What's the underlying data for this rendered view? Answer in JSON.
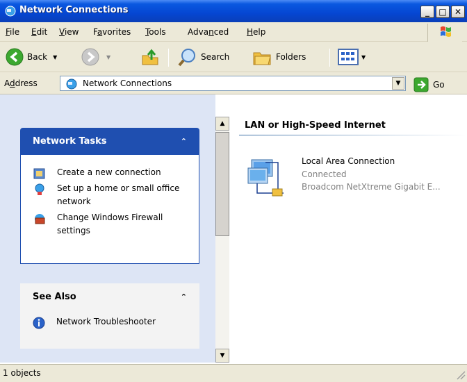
{
  "window": {
    "title": "Network Connections"
  },
  "menu": {
    "items": [
      {
        "pre": "",
        "acc": "F",
        "post": "ile"
      },
      {
        "pre": "",
        "acc": "E",
        "post": "dit"
      },
      {
        "pre": "",
        "acc": "V",
        "post": "iew"
      },
      {
        "pre": "F",
        "acc": "a",
        "post": "vorites"
      },
      {
        "pre": "",
        "acc": "T",
        "post": "ools"
      },
      {
        "pre": "Adva",
        "acc": "n",
        "post": "ced"
      },
      {
        "pre": "",
        "acc": "H",
        "post": "elp"
      }
    ]
  },
  "toolbar": {
    "back_label": "Back",
    "search_label": "Search",
    "folders_label": "Folders"
  },
  "address": {
    "label_pre": "A",
    "label_acc": "d",
    "label_post": "dress",
    "value": "Network Connections",
    "go_label": "Go"
  },
  "network_tasks": {
    "title": "Network Tasks",
    "items": [
      {
        "label": "Create a new connection"
      },
      {
        "label": "Set up a home or small office network"
      },
      {
        "label": "Change Windows Firewall settings"
      }
    ]
  },
  "see_also": {
    "title": "See Also",
    "items": [
      {
        "label": "Network Troubleshooter"
      }
    ]
  },
  "content": {
    "group_title": "LAN or High-Speed Internet",
    "connection": {
      "name": "Local Area Connection",
      "status": "Connected",
      "device": "Broadcom NetXtreme Gigabit E..."
    }
  },
  "status": {
    "text": "1 objects"
  }
}
